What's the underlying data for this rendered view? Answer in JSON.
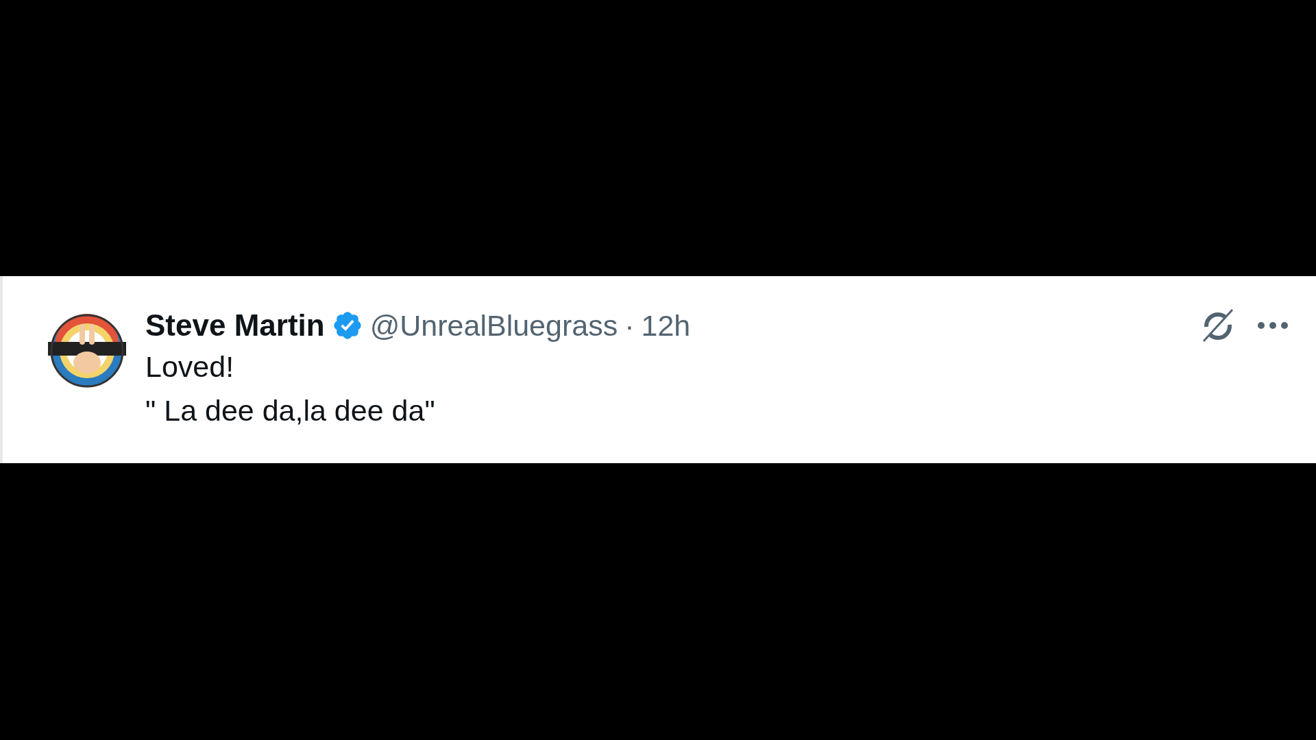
{
  "tweet": {
    "name": "Steve Martin",
    "verified": true,
    "handle": "@UnrealBluegrass",
    "separator": "·",
    "time": "12h",
    "lines": [
      "Loved!",
      "\" La dee da,la dee da\""
    ]
  }
}
